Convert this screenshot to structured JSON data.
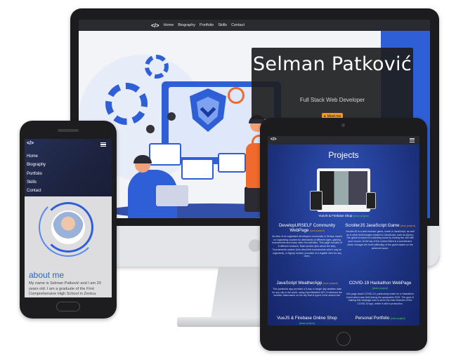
{
  "desktop": {
    "nav": {
      "logo": "</>",
      "links": [
        "Home",
        "Biography",
        "Portfolio",
        "Skills",
        "Contact"
      ]
    },
    "hero": {
      "name": "Selman Patković",
      "role": "Full Stack Web Developer",
      "button_label": "Meet me",
      "button_icon": "person-icon"
    }
  },
  "phone": {
    "nav_logo": "</>",
    "menu": [
      "Home",
      "Biography",
      "Portfolio",
      "Skills",
      "Contact"
    ],
    "about_title": "about me",
    "about_text": "My name is Selman Patković and I am 20 years old. I am a graduate of the First Comprehensive High School in Zenica."
  },
  "tablet": {
    "nav_logo": "</>",
    "title": "Projects",
    "featured_caption": "VueJS & Firebase Shop",
    "featured_tag": "[team project]",
    "projects": [
      {
        "title": "DevelopURSELF Community WebPage",
        "tag": "[solo project]",
        "desc": "An idea of an organised developers community in Zenica, based on organizing courses for attendants of different ages, gaming tournaments and many other fun activities. This page consists of 5 different sections: Main section (info about the site), Tournaments section (info about the tournaments which may be organized), a Signup section (consists of a register form for any user)."
      },
      {
        "title": "ScrollerJS JavaScript Game",
        "tag": "[solo project]",
        "desc": "ScrollerJS is a web-browser game, made in JavaScript, as well as in other technologies related to JavaScript, such as jQuery. The game is based on collecting icons by moving the cart with your mouse. At the top of the screen there is a scoreboard, which changes the level (difficulty) of the game based on the achieved score."
      },
      {
        "title": "JavaScript WeatherApp",
        "tag": "[solo project]",
        "desc": "This particular app provides a 5-day or single day weather data for any city in the world, using OpenWeather API. It retrieves the weather data based on the city that is typed in the search bar."
      },
      {
        "title": "COVID-19 Hackathon WebPage",
        "tag": "[team project]",
        "desc": "Info page about COVID-19, particularly made for a Hackathon event which was held during the quarantine 2020. The goal of making this webpage was to show the main features of the COVID-19 app, which is still in production."
      },
      {
        "title": "VueJS & Firebase Online Shop",
        "tag": "[team project]",
        "desc": ""
      },
      {
        "title": "Personal Portfolio",
        "tag": "[solo project]",
        "desc": ""
      }
    ]
  }
}
